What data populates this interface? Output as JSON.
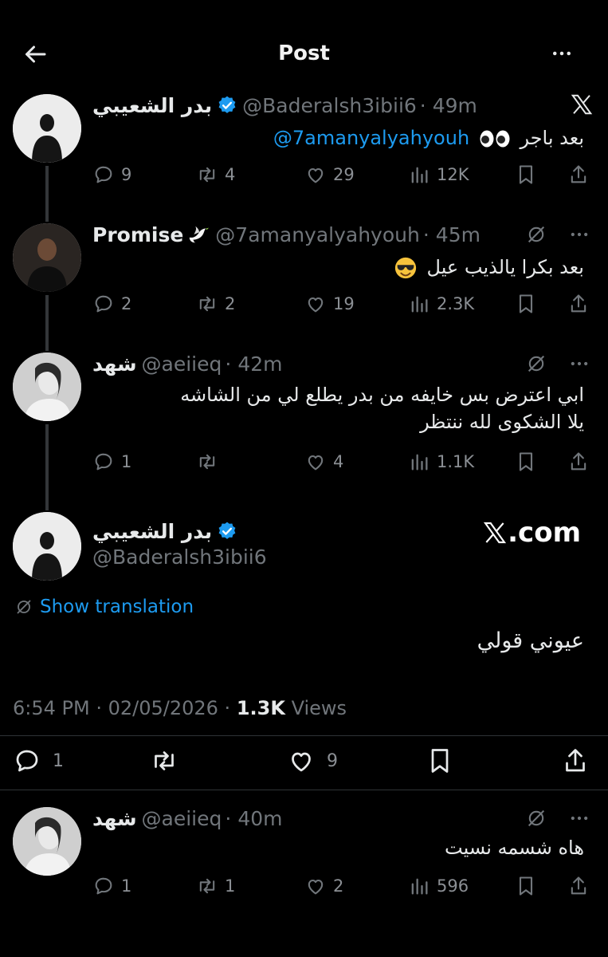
{
  "header": {
    "title": "Post"
  },
  "top_tweet": {
    "name": "بدر الشعيبي",
    "handle": "@Baderalsh3ibii6",
    "time": "49m",
    "text_prefix": "بعد باجر",
    "mention": "@7amanyalyahyouh",
    "replies": "9",
    "reposts": "4",
    "likes": "29",
    "views": "12K"
  },
  "reply1": {
    "name": "Promise",
    "handle": "@7amanyalyahyouh",
    "time": "45m",
    "text": "بعد بكرا يالذيب عيل",
    "replies": "2",
    "reposts": "2",
    "likes": "19",
    "views": "2.3K"
  },
  "reply2": {
    "name": "شهد",
    "handle": "@aeiieq",
    "time": "42m",
    "text_line1": "ابي اعترض بس خايفه من بدر يطلع لي من الشاشه",
    "text_line2": "يلا الشكوى لله ننتظر",
    "replies": "1",
    "reposts": "",
    "likes": "4",
    "views": "1.1K"
  },
  "main_post": {
    "name": "بدر الشعيبي",
    "handle": "@Baderalsh3ibii6",
    "source": ".com",
    "show_translation": "Show translation",
    "text": "عيوني قولي",
    "timestamp": "6:54 PM · 02/05/2026 · ",
    "views_count": "1.3K",
    "views_label": " Views",
    "replies": "1",
    "reposts": "",
    "likes": "9"
  },
  "bottom_reply": {
    "name": "شهد",
    "handle": "@aeiieq",
    "time": "40m",
    "text": "هاه شسمه نسيت",
    "replies": "1",
    "reposts": "1",
    "likes": "2",
    "views": "596"
  },
  "colors": {
    "background": "#000000",
    "link": "#1d9bf0",
    "secondary": "#71767b",
    "verified": "#1d9bf0"
  }
}
